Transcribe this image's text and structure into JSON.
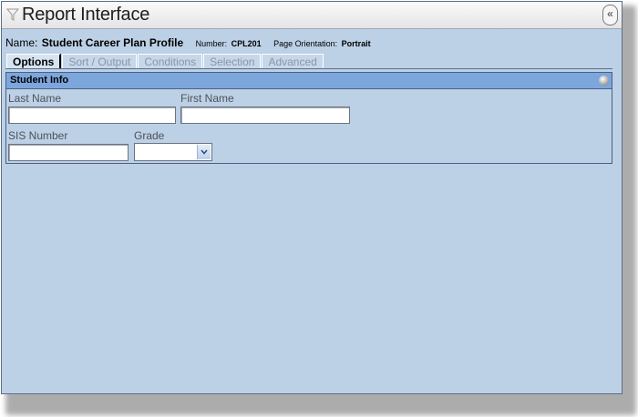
{
  "window": {
    "title": "Report Interface",
    "collapse_glyph": "«",
    "filter_icon": "filter-icon"
  },
  "report": {
    "name_label": "Name:",
    "name": "Student Career Plan Profile",
    "number_label": "Number:",
    "number": "CPL201",
    "orientation_label": "Page Orientation:",
    "orientation": "Portrait"
  },
  "tabs": [
    {
      "label": "Options",
      "active": true
    },
    {
      "label": "Sort / Output",
      "active": false
    },
    {
      "label": "Conditions",
      "active": false
    },
    {
      "label": "Selection",
      "active": false
    },
    {
      "label": "Advanced",
      "active": false
    }
  ],
  "panel": {
    "title": "Student Info",
    "toggle_icon": "collapse-circle-icon",
    "fields": {
      "last_name": {
        "label": "Last Name",
        "value": ""
      },
      "first_name": {
        "label": "First Name",
        "value": ""
      },
      "sis_number": {
        "label": "SIS Number",
        "value": ""
      },
      "grade": {
        "label": "Grade",
        "value": ""
      }
    }
  },
  "colors": {
    "window_background": "#bcd0e6",
    "panel_header": "#7da6dc",
    "border": "#4a6187"
  }
}
